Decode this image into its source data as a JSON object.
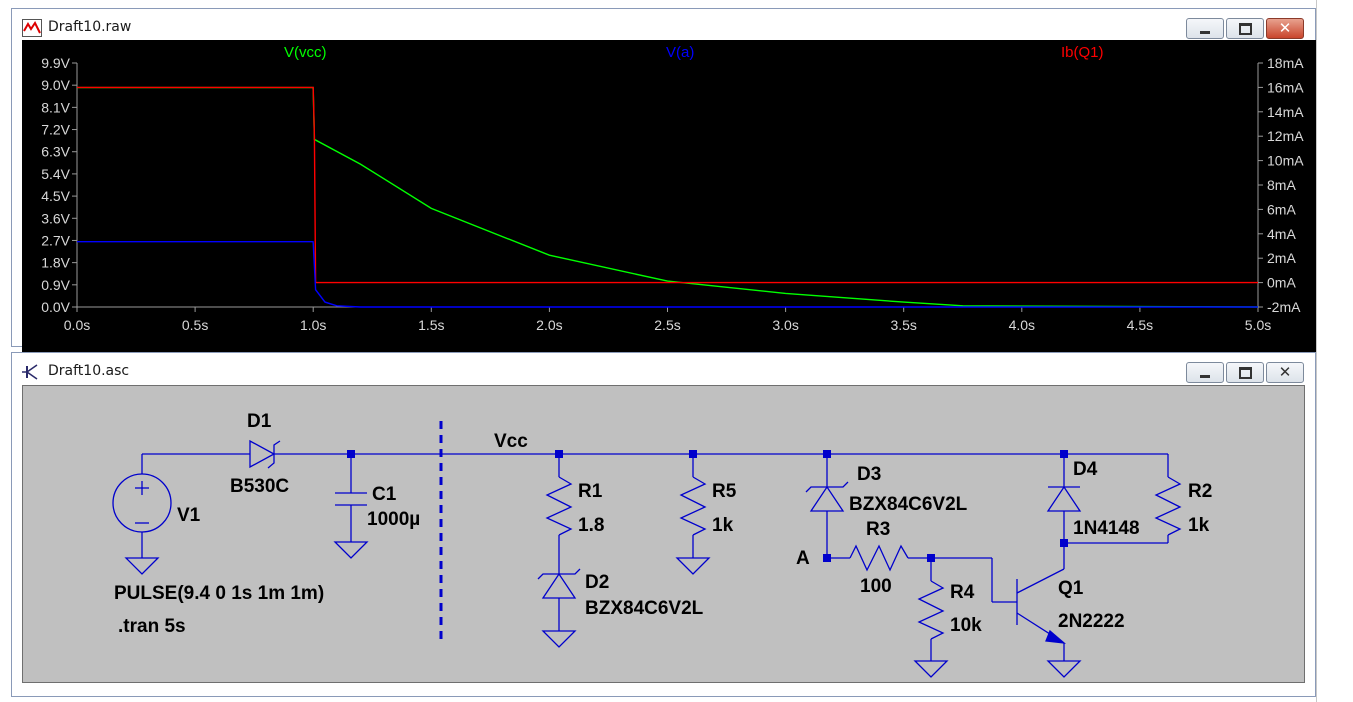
{
  "waveform_window": {
    "title": "Draft10.raw",
    "traces": [
      {
        "label": "V(vcc)",
        "color": "#00ff00"
      },
      {
        "label": "V(a)",
        "color": "#0000ff"
      },
      {
        "label": "Ib(Q1)",
        "color": "#ff0000"
      }
    ],
    "chart_data": {
      "type": "line",
      "x": [
        0.0,
        0.5,
        1.0,
        1.5,
        2.0,
        2.5,
        3.0,
        3.5,
        4.0,
        4.5,
        5.0
      ],
      "x_tick_labels": [
        "0.0s",
        "0.5s",
        "1.0s",
        "1.5s",
        "2.0s",
        "2.5s",
        "3.0s",
        "3.5s",
        "4.0s",
        "4.5s",
        "5.0s"
      ],
      "xlim": [
        0,
        5
      ],
      "y_left_tick_labels": [
        "9.9V",
        "9.0V",
        "8.1V",
        "7.2V",
        "6.3V",
        "5.4V",
        "4.5V",
        "3.6V",
        "2.7V",
        "1.8V",
        "0.9V",
        "0.0V"
      ],
      "y_left_lim": [
        0,
        9.9
      ],
      "y_right_tick_labels": [
        "18mA",
        "16mA",
        "14mA",
        "12mA",
        "10mA",
        "8mA",
        "6mA",
        "4mA",
        "2mA",
        "0mA",
        "-2mA"
      ],
      "y_right_lim": [
        -2,
        18
      ],
      "series": [
        {
          "name": "V(vcc)",
          "axis": "left",
          "points": [
            [
              0,
              8.9
            ],
            [
              0.999,
              8.9
            ],
            [
              1.0,
              8.8
            ],
            [
              1.005,
              6.8
            ],
            [
              1.2,
              5.8
            ],
            [
              1.5,
              4.0
            ],
            [
              2.0,
              2.1
            ],
            [
              2.5,
              1.05
            ],
            [
              3.0,
              0.55
            ],
            [
              3.5,
              0.2
            ],
            [
              3.75,
              0.05
            ],
            [
              5.0,
              0.0
            ]
          ]
        },
        {
          "name": "V(a)",
          "axis": "left",
          "points": [
            [
              0,
              2.65
            ],
            [
              0.999,
              2.65
            ],
            [
              1.0,
              2.6
            ],
            [
              1.01,
              0.7
            ],
            [
              1.05,
              0.2
            ],
            [
              1.1,
              0.05
            ],
            [
              1.2,
              0.0
            ],
            [
              5.0,
              0.0
            ]
          ]
        },
        {
          "name": "Ib(Q1)",
          "axis": "right",
          "points": [
            [
              0,
              16.0
            ],
            [
              0.999,
              16.0
            ],
            [
              1.0,
              16.0
            ],
            [
              1.005,
              12.0
            ],
            [
              1.01,
              0.0
            ],
            [
              5.0,
              0.0
            ]
          ]
        }
      ]
    },
    "controls": {
      "minimize": "minimize",
      "maximize": "maximize",
      "close": "✕"
    }
  },
  "schematic_window": {
    "title": "Draft10.asc",
    "controls": {
      "minimize": "minimize",
      "maximize": "maximize",
      "close": "✕"
    },
    "labels": {
      "D1": "D1",
      "D1_model": "B530C",
      "C1": "C1",
      "C1_value": "1000µ",
      "V1": "V1",
      "pulse": "PULSE(9.4 0 1s 1m 1m)",
      "tran": ".tran 5s",
      "net_vcc": "Vcc",
      "R1": "R1",
      "R1_value": "1.8",
      "D2": "D2",
      "D2_model": "BZX84C6V2L",
      "R5": "R5",
      "R5_value": "1k",
      "D3": "D3",
      "D3_model": "BZX84C6V2L",
      "R3": "R3",
      "R3_value": "100",
      "net_a": "A",
      "R4": "R4",
      "R4_value": "10k",
      "D4": "D4",
      "D4_model": "1N4148",
      "R2": "R2",
      "R2_value": "1k",
      "Q1": "Q1",
      "Q1_model": "2N2222"
    }
  }
}
